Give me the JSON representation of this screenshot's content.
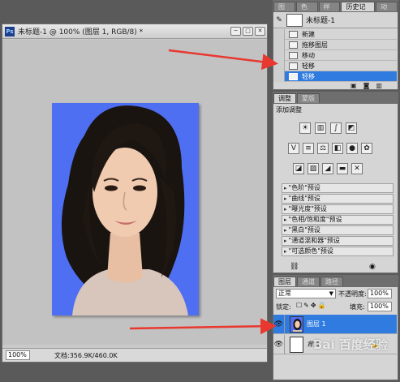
{
  "document": {
    "ps_badge": "Ps",
    "title": "未标题-1 @ 100% (图层 1, RGB/8) *",
    "buttons": {
      "minimize": "─",
      "maximize": "□",
      "close": "✕"
    },
    "zoom": "100%",
    "status_text": "文档:356.9K/460.0K"
  },
  "history_panel": {
    "tabs": [
      "图层",
      "色板",
      "样式",
      "历史记录",
      "动作"
    ],
    "active_tab": "历史记录",
    "snapshot_name": "未标题-1",
    "items": [
      "新建",
      "拖移图层",
      "移动",
      "轻移",
      "轻移"
    ],
    "selected_index": 4
  },
  "adjustments_panel": {
    "tabs": [
      "调整",
      "蒙版"
    ],
    "active_tab": "调整",
    "heading": "添加调整",
    "presets": [
      "\"色阶\"预设",
      "\"曲线\"预设",
      "\"曝光度\"预设",
      "\"色相/饱和度\"预设",
      "\"黑白\"预设",
      "\"通道混和器\"预设",
      "\"可选颜色\"预设"
    ]
  },
  "layers_panel": {
    "tabs": [
      "图层",
      "通道",
      "路径"
    ],
    "active_tab": "图层",
    "blend_mode": "正常",
    "opacity_label": "不透明度:",
    "opacity_value": "100%",
    "lock_label": "锁定:",
    "fill_label": "填充:",
    "fill_value": "100%",
    "layers": [
      {
        "name": "图层 1",
        "selected": true,
        "visible": true
      },
      {
        "name": "背景",
        "selected": false,
        "visible": true,
        "locked": true
      }
    ]
  },
  "watermark": "Bai 百度经验",
  "colors": {
    "photo_background": "#4f6ff2",
    "selection": "#2f7be0",
    "annotation_arrow": "#e8382f",
    "panel_bg": "#d5d5d5",
    "app_bg": "#5a5a5a"
  },
  "icons": [
    "ps-app-icon",
    "history-brush-icon",
    "snapshot-icon",
    "step-icon",
    "visibility-eye-icon",
    "lock-icon",
    "new-layer-icon",
    "trash-icon",
    "camera-icon"
  ]
}
